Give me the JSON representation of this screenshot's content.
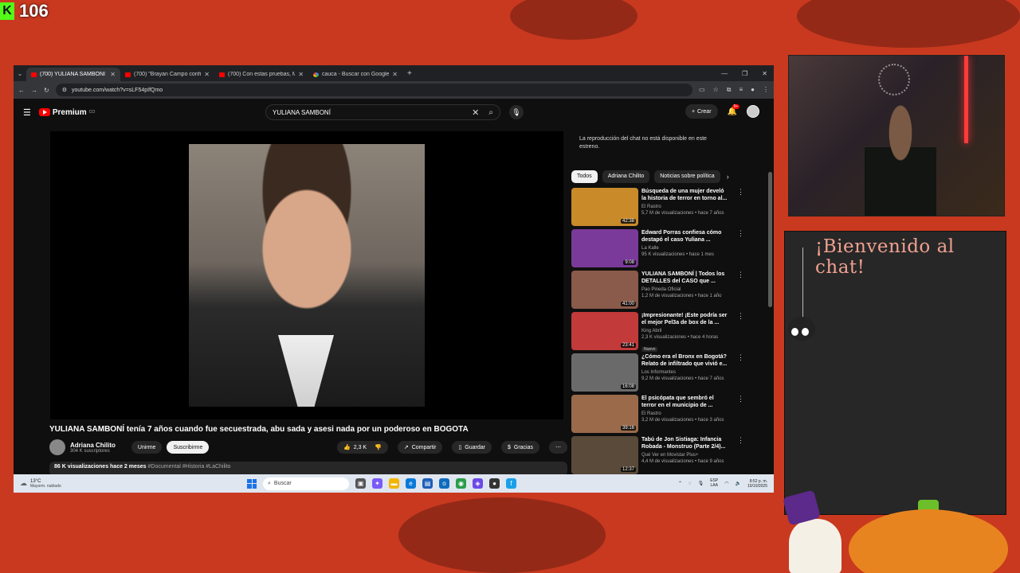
{
  "overlay": {
    "kick_count": "106",
    "chat_title": "¡Bienvenido al chat!"
  },
  "tabs": [
    {
      "title": "(700) YULIANA SAMBONÍ t",
      "active": true
    },
    {
      "title": "(700) \"Brayan Campo confiesa",
      "active": false
    },
    {
      "title": "(700) Con estas pruebas, Medic",
      "active": false
    },
    {
      "title": "cauca - Buscar con Google",
      "active": false
    }
  ],
  "address": {
    "url": "youtube.com/watch?v=sLF54pIfQmo"
  },
  "youtube": {
    "logo": "Premium",
    "logo_sup": "CO",
    "search_query": "YULIANA SAMBONÍ",
    "create_label": "Crear",
    "notif_badge": "9+",
    "video_title": "YULIANA SAMBONÍ tenía 7 años cuando fue secuestrada, abu sada y asesi nada por un poderoso en BOGOTA",
    "channel": {
      "name": "Adriana Chilito",
      "subs": "304 K suscriptores",
      "join": "Unirme",
      "subscribe": "Suscribirme"
    },
    "actions": {
      "likes": "2,3 K",
      "share": "Compartir",
      "save": "Guardar",
      "thanks": "Gracias"
    },
    "description": {
      "stats": "86 K visualizaciones  hace 2 meses",
      "tags": "#Documental #Historia #LaChilito"
    },
    "chat_disabled": "La reproducción del chat no está disponible en este estreno.",
    "chips": [
      "Todos",
      "Adriana Chilito",
      "Noticias sobre política"
    ],
    "related": [
      {
        "title": "Búsqueda de una mujer develó la historia de terror en torno al...",
        "channel": "El Rastro",
        "stats": "5,7 M de visualizaciones • hace 7 años",
        "duration": "42:38",
        "badge": "",
        "color": "#c98a2a"
      },
      {
        "title": "Edward Porras confiesa cómo destapó el caso Yuliana ...",
        "channel": "La Kalle",
        "stats": "95 K visualizaciones • hace 1 mes",
        "duration": "9:08",
        "badge": "",
        "color": "#7a3a9a"
      },
      {
        "title": "YULIANA SAMBONÍ | Todos los DETALLES del CASO que ...",
        "channel": "Pao Pineda Oficial",
        "stats": "1,2 M de visualizaciones • hace 1 año",
        "duration": "41:00",
        "badge": "",
        "color": "#8a5a4a"
      },
      {
        "title": "¡Impresionante! ¡Este podría ser el mejor Pel3a de box de la ...",
        "channel": "King Abril",
        "stats": "2,3 K visualizaciones • hace 4 horas",
        "duration": "23:41",
        "badge": "Nuevo",
        "color": "#c23a3a"
      },
      {
        "title": "¿Cómo era el Bronx en Bogotá? Relato de infiltrado que vivió e...",
        "channel": "Los Informantes",
        "stats": "9,2 M de visualizaciones • hace 7 años",
        "duration": "16:08",
        "badge": "",
        "color": "#6a6a6a"
      },
      {
        "title": "El psicópata que sembró el terror en el municipio de ...",
        "channel": "El Rastro",
        "stats": "3,2 M de visualizaciones • hace 3 años",
        "duration": "39:16",
        "badge": "",
        "color": "#9a6a4a"
      },
      {
        "title": "Tabú de Jon Sistiaga: Infancia Robada - Monstruo (Parte 2/4)...",
        "channel": "Qué Ver en Movistar Plus+",
        "stats": "4,4 M de visualizaciones • hace 9 años",
        "duration": "12:37",
        "badge": "",
        "color": "#5a4a3a"
      }
    ]
  },
  "taskbar": {
    "temp": "13°C",
    "weather": "Mayorm. nublado",
    "search": "Buscar",
    "lang_top": "ESP",
    "lang_bottom": "LAA",
    "time": "8:52 p. m.",
    "date": "10/10/2025"
  }
}
